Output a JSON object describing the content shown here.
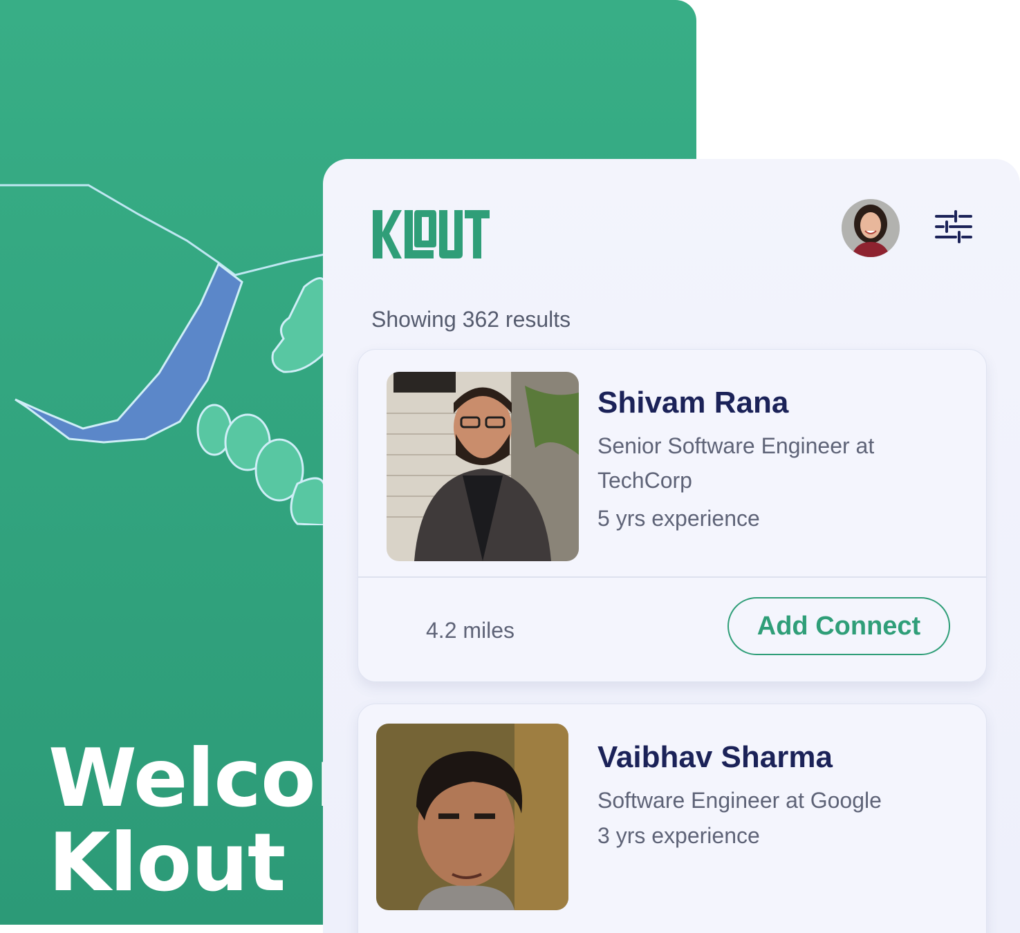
{
  "background": {
    "welcome_title": "Welcome to\nKlout"
  },
  "app": {
    "logo_text": "KLOUT",
    "results_text": "Showing 362 results",
    "colors": {
      "brand_green": "#2f9e78",
      "name_navy": "#1b2258"
    },
    "icons": {
      "filter": "sliders-icon",
      "avatar": "user-avatar"
    }
  },
  "people": [
    {
      "name": "Shivam Rana",
      "role": "Senior Software Engineer at TechCorp",
      "experience": "5 yrs experience",
      "distance": "4.2 miles",
      "action_label": "Add Connect"
    },
    {
      "name": "Vaibhav Sharma",
      "role": "Software Engineer at Google",
      "experience": "3 yrs experience"
    }
  ]
}
